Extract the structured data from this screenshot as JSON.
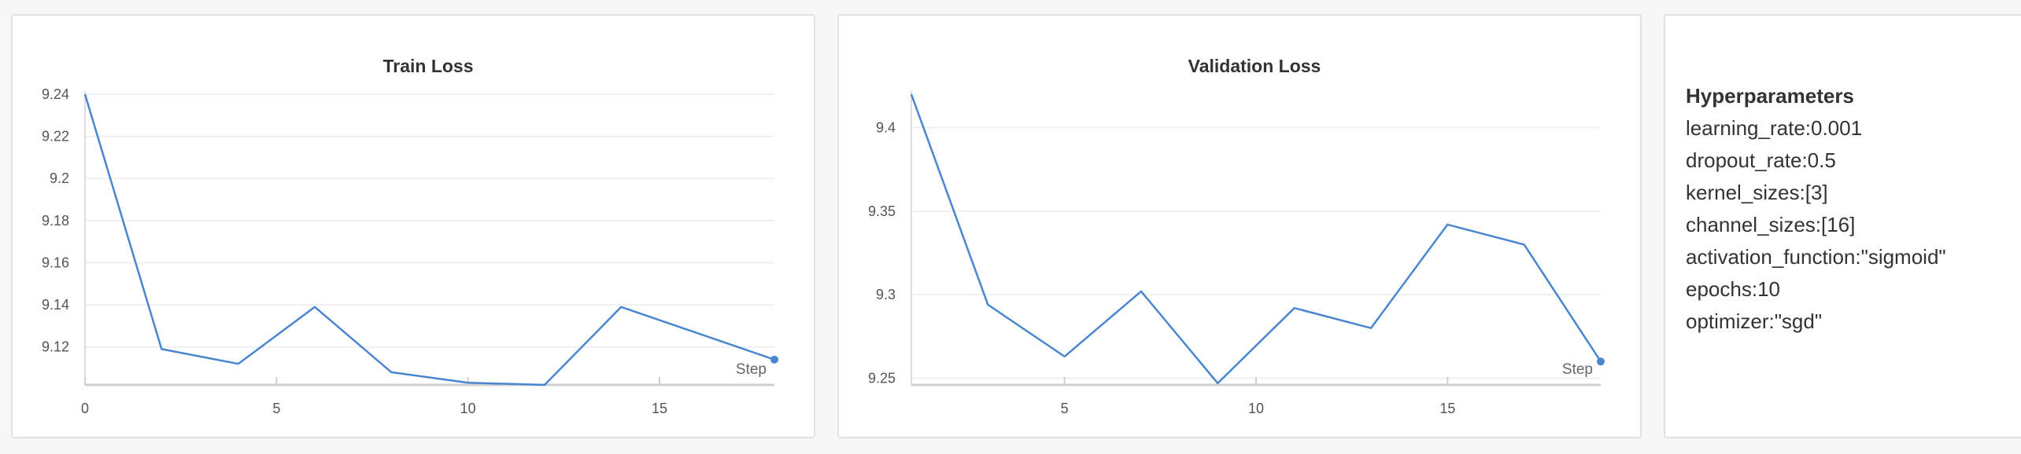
{
  "chart_data": [
    {
      "type": "line",
      "title": "Train Loss",
      "xlabel": "Step",
      "ylabel": "",
      "x": [
        0,
        2,
        4,
        6,
        8,
        10,
        12,
        14,
        18
      ],
      "series": [
        {
          "values": [
            9.24,
            9.119,
            9.112,
            9.139,
            9.108,
            9.103,
            9.102,
            9.139,
            9.114
          ]
        }
      ],
      "xlim": [
        0,
        18
      ],
      "ylim": [
        9.102,
        9.24
      ],
      "xticks": [
        0,
        5,
        10,
        15
      ],
      "xtick_labels": [
        "0",
        "5",
        "10",
        "15"
      ],
      "yticks": [
        9.12,
        9.14,
        9.16,
        9.18,
        9.2,
        9.22,
        9.24
      ],
      "ytick_labels": [
        "9.12",
        "9.14",
        "9.16",
        "9.18",
        "9.2",
        "9.22",
        "9.24"
      ],
      "grid": true,
      "color": "#4a86d0"
    },
    {
      "type": "line",
      "title": "Validation Loss",
      "xlabel": "Step",
      "ylabel": "",
      "x": [
        1,
        3,
        5,
        7,
        9,
        11,
        13,
        15,
        17,
        19
      ],
      "series": [
        {
          "values": [
            9.42,
            9.294,
            9.263,
            9.302,
            9.247,
            9.292,
            9.28,
            9.342,
            9.33,
            9.26
          ]
        }
      ],
      "xlim": [
        1,
        19
      ],
      "ylim": [
        9.246,
        9.42
      ],
      "xticks": [
        5,
        10,
        15
      ],
      "xtick_labels": [
        "5",
        "10",
        "15"
      ],
      "yticks": [
        9.25,
        9.3,
        9.35,
        9.4
      ],
      "ytick_labels": [
        "9.25",
        "9.3",
        "9.35",
        "9.4"
      ],
      "grid": true,
      "color": "#4a86d0"
    }
  ],
  "hyperparameters": {
    "title": "Hyperparameters",
    "lines": [
      "learning_rate:0.001",
      "dropout_rate:0.5",
      "kernel_sizes:[3]",
      "channel_sizes:[16]",
      "activation_function:\"sigmoid\"",
      "epochs:10",
      "optimizer:\"sgd\""
    ]
  }
}
